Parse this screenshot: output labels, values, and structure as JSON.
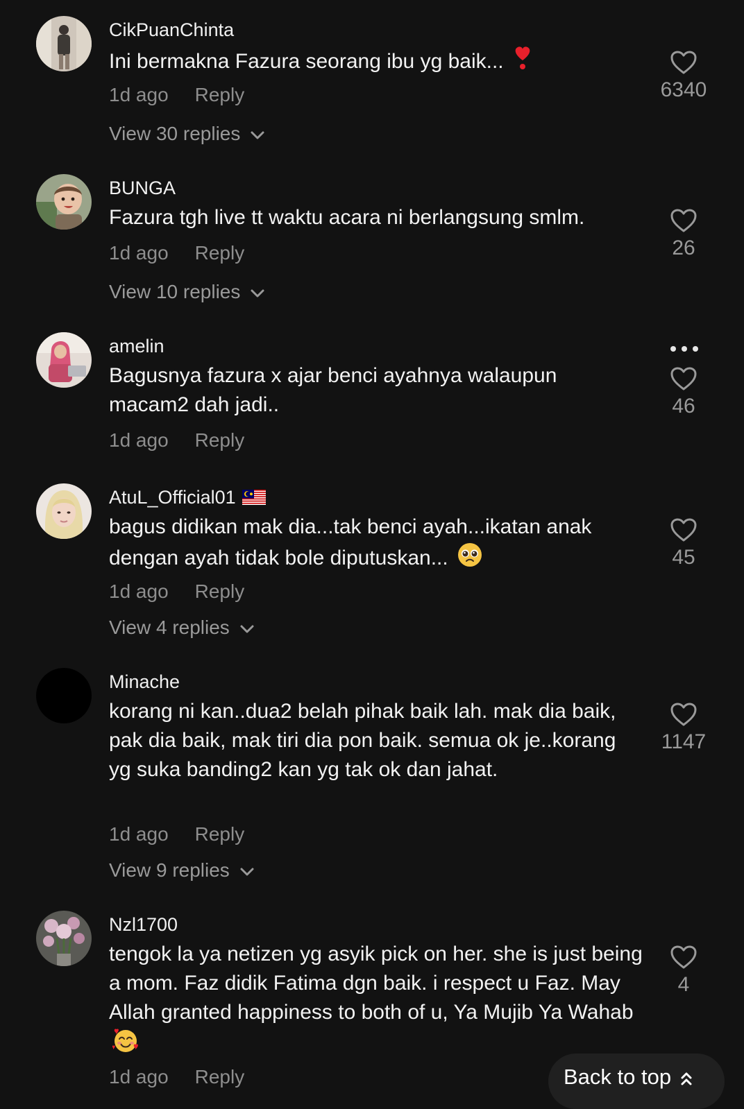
{
  "colors": {
    "background": "#121212",
    "primary_text": "#f2f2f2",
    "secondary_text": "#8e8e8e",
    "button_bg": "#202020"
  },
  "comments": [
    {
      "username": "CikPuanChinta",
      "text": "Ini bermakna Fazura seorang ibu yg baik...",
      "emoji": "heart-exclamation",
      "time": "1d ago",
      "reply_label": "Reply",
      "likes": "6340",
      "view_replies": "View 30 replies"
    },
    {
      "username": "BUNGA",
      "text": "Fazura tgh live tt waktu acara ni berlangsung smlm.",
      "time": "1d ago",
      "reply_label": "Reply",
      "likes": "26",
      "view_replies": "View 10 replies"
    },
    {
      "username": "amelin",
      "text": "Bagusnya fazura x ajar benci ayahnya walaupun macam2 dah jadi..",
      "time": "1d ago",
      "reply_label": "Reply",
      "likes": "46"
    },
    {
      "username": "AtuL_Official01",
      "flag": "malaysia-flag",
      "text": "bagus didikan mak dia...tak benci ayah...ikatan anak dengan ayah tidak bole diputuskan...",
      "emoji": "pleading-face",
      "time": "1d ago",
      "reply_label": "Reply",
      "likes": "45",
      "view_replies": "View 4 replies"
    },
    {
      "username": "Minache",
      "text": "korang ni kan..dua2 belah pihak baik lah. mak dia baik, pak dia baik, mak tiri dia pon baik. semua ok je..korang yg suka banding2 kan yg tak ok dan jahat.",
      "time": "1d ago",
      "reply_label": "Reply",
      "likes": "1147",
      "view_replies": "View 9 replies"
    },
    {
      "username": "Nzl1700",
      "text": "tengok la ya netizen yg asyik pick on her. she is just being a mom. Faz didik Fatima dgn baik. i respect u Faz. May Allah granted happiness to both of u, Ya Mujib Ya Wahab",
      "emoji": "smiling-face-with-hearts",
      "time": "1d ago",
      "reply_label": "Reply",
      "likes": "4"
    }
  ],
  "back_to_top": {
    "label": "Back to top",
    "icon": "double-chevron-up-icon"
  }
}
